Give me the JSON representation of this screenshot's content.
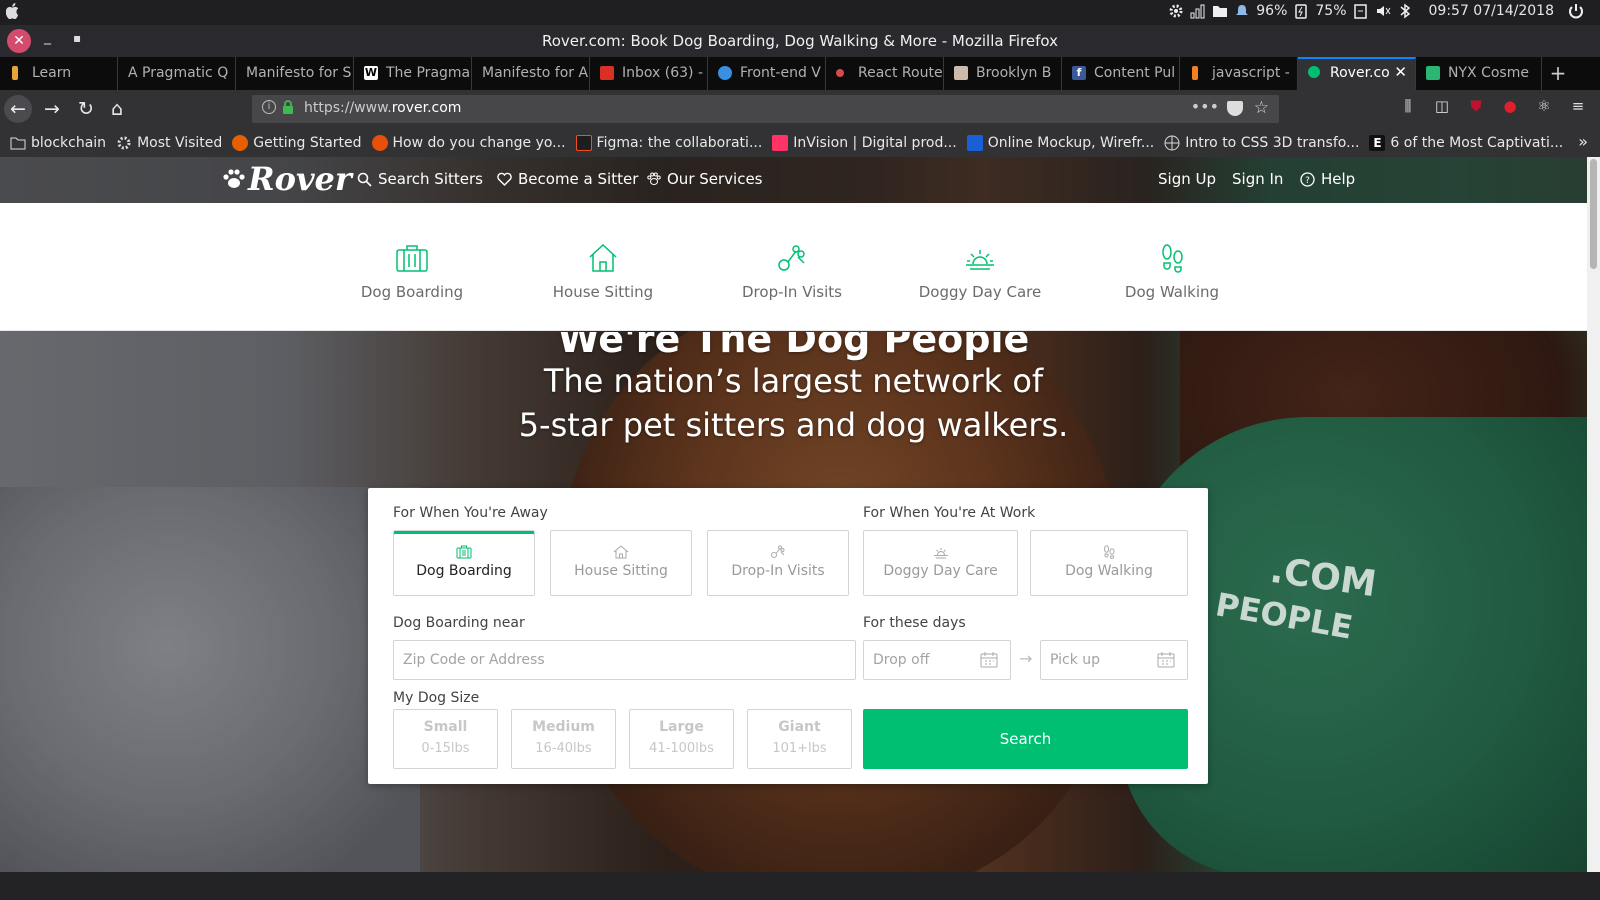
{
  "system": {
    "battery1": "96%",
    "battery2": "75%",
    "clock": "09:57 07/14/2018"
  },
  "window": {
    "title": "Rover.com: Book Dog Boarding, Dog Walking & More - Mozilla Firefox"
  },
  "tabs": [
    {
      "label": "Learn",
      "color": "#e8a33d"
    },
    {
      "label": "A Pragmatic Q",
      "color": ""
    },
    {
      "label": "Manifesto for S",
      "color": ""
    },
    {
      "label": "The Pragma",
      "color": "#ffffff"
    },
    {
      "label": "Manifesto for A",
      "color": ""
    },
    {
      "label": "Inbox (63) -",
      "color": "#d93025"
    },
    {
      "label": "Front-end V",
      "color": "#3b8fe0"
    },
    {
      "label": "React Route",
      "color": "#d64a4a"
    },
    {
      "label": "Brooklyn B",
      "color": "#ccbbaa"
    },
    {
      "label": "Content Pul",
      "color": "#3b5998"
    },
    {
      "label": "javascript -",
      "color": "#f48024"
    },
    {
      "label": "Rover.co",
      "color": "#00bf72"
    },
    {
      "label": "NYX Cosme",
      "color": "#2bb673"
    }
  ],
  "url": {
    "prefix": "https://www.",
    "domain": "rover.com"
  },
  "bookmarks": [
    {
      "label": "blockchain",
      "color": ""
    },
    {
      "label": "Most Visited",
      "color": ""
    },
    {
      "label": "Getting Started",
      "color": "#e66000"
    },
    {
      "label": "How do you change yo...",
      "color": "#e8500a"
    },
    {
      "label": "Figma: the collaborati...",
      "color": "#1e1e1e"
    },
    {
      "label": "InVision | Digital prod...",
      "color": "#ff3366"
    },
    {
      "label": "Online Mockup, Wirefr...",
      "color": "#1a5fd6"
    },
    {
      "label": "Intro to CSS 3D transfo...",
      "color": ""
    },
    {
      "label": "6 of the Most Captivati...",
      "color": "#111111"
    }
  ],
  "rover": {
    "logo": "Rover",
    "nav": {
      "search_sitters": "Search Sitters",
      "become_sitter": "Become a Sitter",
      "our_services": "Our Services",
      "sign_up": "Sign Up",
      "sign_in": "Sign In",
      "help": "Help"
    },
    "services": [
      "Dog Boarding",
      "House Sitting",
      "Drop-In Visits",
      "Doggy Day Care",
      "Dog Walking"
    ],
    "headline": "We're The Dog People",
    "subline1": "The nation’s largest network of",
    "subline2": "5-star pet sitters and dog walkers.",
    "shirt_text1": ".COM",
    "shirt_text2": "PEOPLE",
    "brand_color": "#00bf72"
  },
  "form": {
    "away_label": "For When You're Away",
    "work_label": "For When You're At Work",
    "services": [
      "Dog Boarding",
      "House Sitting",
      "Drop-In Visits",
      "Doggy Day Care",
      "Dog Walking"
    ],
    "selected_service": "Dog Boarding",
    "near_label": "Dog Boarding near",
    "address_placeholder": "Zip Code or Address",
    "days_label": "For these days",
    "dropoff_placeholder": "Drop off",
    "pickup_placeholder": "Pick up",
    "size_label": "My Dog Size",
    "sizes": [
      {
        "name": "Small",
        "weight": "0-15lbs"
      },
      {
        "name": "Medium",
        "weight": "16-40lbs"
      },
      {
        "name": "Large",
        "weight": "41-100lbs"
      },
      {
        "name": "Giant",
        "weight": "101+lbs"
      }
    ],
    "search_button": "Search"
  }
}
